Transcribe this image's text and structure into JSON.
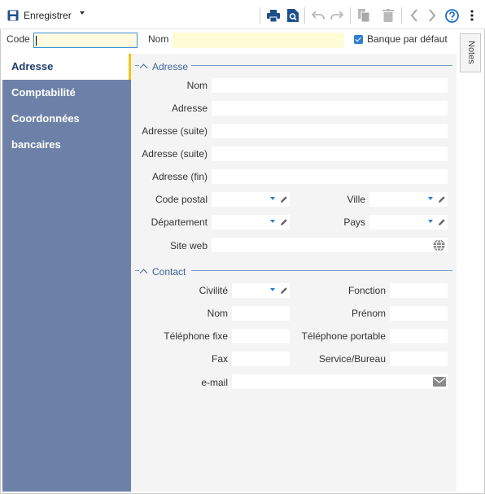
{
  "toolbar": {
    "save_label": "Enregistrer",
    "icons": [
      "save-icon",
      "print-icon",
      "print-preview-icon",
      "undo-icon",
      "redo-icon",
      "copy-icon",
      "delete-icon",
      "previous-icon",
      "next-icon",
      "help-icon",
      "more-icon"
    ]
  },
  "header": {
    "code_label": "Code",
    "code_value": "",
    "nom_label": "Nom",
    "nom_value": "",
    "bank_default_label": "Banque par défaut",
    "bank_default_checked": true
  },
  "notes_tab": {
    "label": "Notes"
  },
  "nav": {
    "items": [
      {
        "label": "Adresse",
        "active": true
      },
      {
        "label": "Comptabilité",
        "active": false
      },
      {
        "label": "Coordonnées bancaires",
        "active": false
      }
    ]
  },
  "adresse": {
    "section_title": "Adresse",
    "nom_label": "Nom",
    "adresse_label": "Adresse",
    "adresse_suite1_label": "Adresse (suite)",
    "adresse_suite2_label": "Adresse (suite)",
    "adresse_fin_label": "Adresse (fin)",
    "code_postal_label": "Code postal",
    "ville_label": "Ville",
    "departement_label": "Département",
    "pays_label": "Pays",
    "site_web_label": "Site web"
  },
  "contact": {
    "section_title": "Contact",
    "civilite_label": "Civilité",
    "fonction_label": "Fonction",
    "nom_label": "Nom",
    "prenom_label": "Prénom",
    "tel_fixe_label": "Téléphone fixe",
    "tel_portable_label": "Téléphone portable",
    "fax_label": "Fax",
    "service_label": "Service/Bureau",
    "email_label": "e-mail"
  },
  "colors": {
    "accent": "#2e7dd1",
    "nav_bg": "#6d81a8",
    "nav_active_text": "#1f3c6e",
    "active_marker": "#f0c419",
    "section_title": "#3a6598",
    "required_field_bg": "#fffbd6"
  }
}
